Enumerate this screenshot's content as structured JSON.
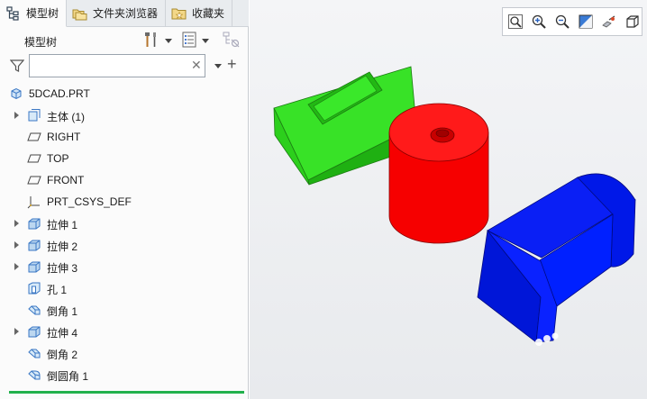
{
  "tabs": [
    {
      "label": "模型树",
      "icon": "model-tree-icon",
      "active": true
    },
    {
      "label": "文件夹浏览器",
      "icon": "folder-browser-icon",
      "active": false
    },
    {
      "label": "收藏夹",
      "icon": "favorites-icon",
      "active": false
    }
  ],
  "tree_header": {
    "title": "模型树",
    "tools": [
      "settings-tools-icon",
      "show-columns-icon",
      "display-filter-icon"
    ]
  },
  "filter": {
    "value": "",
    "placeholder": ""
  },
  "tree": [
    {
      "label": "5DCAD.PRT",
      "icon": "part-icon",
      "expandable": false,
      "root": true
    },
    {
      "label": "主体 (1)",
      "icon": "body-icon",
      "expandable": true
    },
    {
      "label": "RIGHT",
      "icon": "datum-plane-icon",
      "expandable": false
    },
    {
      "label": "TOP",
      "icon": "datum-plane-icon",
      "expandable": false
    },
    {
      "label": "FRONT",
      "icon": "datum-plane-icon",
      "expandable": false
    },
    {
      "label": "PRT_CSYS_DEF",
      "icon": "coordinate-system-icon",
      "expandable": false
    },
    {
      "label": "拉伸 1",
      "icon": "extrude-icon",
      "expandable": true
    },
    {
      "label": "拉伸 2",
      "icon": "extrude-icon",
      "expandable": true
    },
    {
      "label": "拉伸 3",
      "icon": "extrude-icon",
      "expandable": true
    },
    {
      "label": "孔 1",
      "icon": "hole-icon",
      "expandable": false
    },
    {
      "label": "倒角 1",
      "icon": "chamfer-icon",
      "expandable": false
    },
    {
      "label": "拉伸 4",
      "icon": "extrude-icon",
      "expandable": true
    },
    {
      "label": "倒角 2",
      "icon": "chamfer-icon",
      "expandable": false
    },
    {
      "label": "倒圆角 1",
      "icon": "round-icon",
      "expandable": false
    }
  ],
  "view_toolbar": [
    "refit-icon",
    "zoom-in-icon",
    "zoom-out-icon",
    "repaint-icon",
    "spin-center-icon",
    "saved-orientations-icon"
  ],
  "colors": {
    "green_block": "#2ee01f",
    "red_cylinder": "#ff0000",
    "blue_part": "#0019ff",
    "insert_line": "#22b14c"
  }
}
